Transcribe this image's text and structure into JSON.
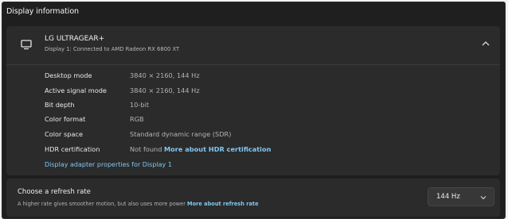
{
  "section_title": "Display information",
  "monitor": {
    "icon": "monitor-icon",
    "name": "LG ULTRAGEAR+",
    "subtitle": "Display 1: Connected to AMD Radeon RX 6800 XT",
    "expanded_icon": "chevron-up-icon"
  },
  "details": [
    {
      "label": "Desktop mode",
      "value": "3840 × 2160, 144 Hz"
    },
    {
      "label": "Active signal mode",
      "value": "3840 × 2160, 144 Hz"
    },
    {
      "label": "Bit depth",
      "value": "10-bit"
    },
    {
      "label": "Color format",
      "value": "RGB"
    },
    {
      "label": "Color space",
      "value": "Standard dynamic range (SDR)"
    },
    {
      "label": "HDR certification",
      "value": "Not found",
      "link": "More about HDR certification"
    }
  ],
  "adapter_link": "Display adapter properties for Display 1",
  "refresh": {
    "title": "Choose a refresh rate",
    "description": "A higher rate gives smoother motion, but also uses more power",
    "link": "More about refresh rate",
    "selected": "144 Hz",
    "dropdown_icon": "chevron-down-icon"
  },
  "colors": {
    "background": "#1f1f1f",
    "card": "#2b2b2b",
    "link": "#7fc7f0"
  }
}
